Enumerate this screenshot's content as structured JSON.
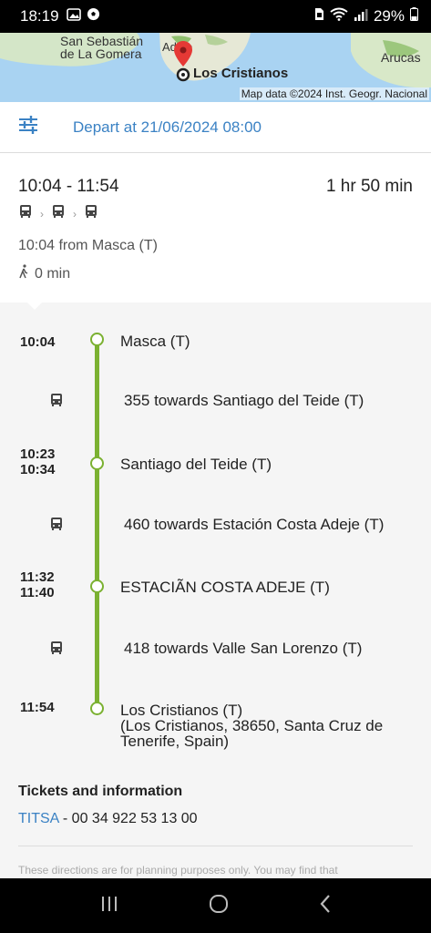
{
  "status_bar": {
    "time": "18:19",
    "battery": "29%"
  },
  "map": {
    "place_1": "San Sebastián",
    "place_2": "de La Gomera",
    "place_3": "Adeje",
    "place_4": "Los Cristianos",
    "place_5": "Arucas",
    "credit": "Map data ©2024 Inst. Geogr. Nacional"
  },
  "depart": {
    "label": "Depart at 21/06/2024 08:00"
  },
  "summary": {
    "times": "10:04 - 11:54",
    "duration": "1 hr 50 min",
    "from": "10:04 from Masca (T)",
    "walk": "0 min"
  },
  "timeline": {
    "stops": [
      {
        "times": [
          "10:04"
        ],
        "name": "Masca (T)"
      },
      {
        "times": [
          "10:23",
          "10:34"
        ],
        "name": "Santiago del Teide (T)"
      },
      {
        "times": [
          "11:32",
          "11:40"
        ],
        "name": "ESTACIÃN COSTA ADEJE (T)"
      },
      {
        "times": [
          "11:54"
        ],
        "name": "Los Cristianos (T)",
        "address": "(Los Cristianos, 38650, Santa Cruz de Tenerife, Spain)"
      }
    ],
    "legs": [
      "355 towards Santiago del Teide (T)",
      "460 towards Estación Costa Adeje (T)",
      "418 towards Valle San Lorenzo (T)"
    ]
  },
  "tickets": {
    "heading": "Tickets and information",
    "operator": "TITSA",
    "phone": " - 00 34 922 53 13 00"
  },
  "disclaimer": "These directions are for planning purposes only. You may find that",
  "colors": {
    "route": "#7bb131",
    "link": "#3b82c4"
  }
}
